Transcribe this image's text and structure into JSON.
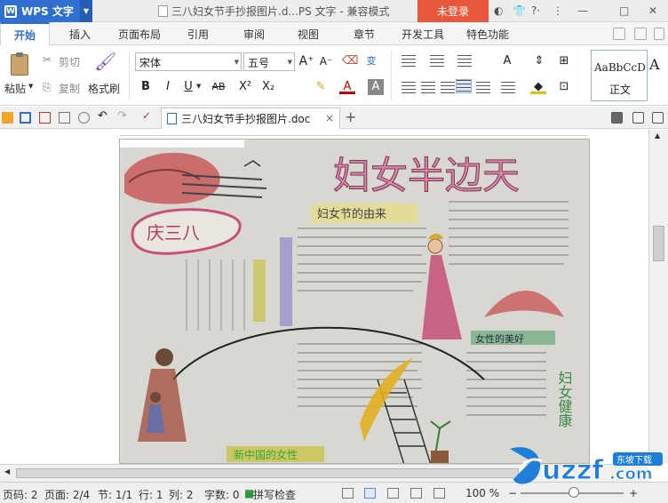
{
  "titlebar": {
    "app_name": "WPS 文字",
    "logo_letter": "W",
    "document_title": "三八妇女节手抄报图片.d...PS 文字 - 兼容模式",
    "login_label": "未登录"
  },
  "tabs": [
    "开始",
    "插入",
    "页面布局",
    "引用",
    "审阅",
    "视图",
    "章节",
    "开发工具",
    "特色功能"
  ],
  "ribbon": {
    "paste_label": "粘贴",
    "cut_label": "剪切",
    "copy_label": "复制",
    "format_painter_label": "格式刷",
    "font_name": "宋体",
    "font_size": "五号",
    "bold": "B",
    "italic": "I",
    "underline": "U",
    "strike": "AB",
    "superscript": "X²",
    "subscript": "X₂",
    "style_sample": "AaBbCcD",
    "style_name": "正文",
    "style_more": "A"
  },
  "doc_tab": {
    "name": "三八妇女节手抄报图片.doc",
    "close": "×",
    "add": "+"
  },
  "poster": {
    "headline": "妇女半边天",
    "badge": "庆三八",
    "subhead_left": "妇女节的由来",
    "subhead_right": "女性的美好",
    "bottom_banner": "新中国的女性",
    "side_text": "妇女健康"
  },
  "status": {
    "page_code": "页码: 2",
    "page": "页面: 2/4",
    "section": "节: 1/1",
    "row": "行: 1",
    "col": "列: 2",
    "words": "字数: 0",
    "spell": "拼写检查",
    "zoom": "100 %",
    "zoom_fraction": 0.52
  },
  "watermark": {
    "brand": "uzzf",
    "suffix": ".com",
    "tag": "东坡下载"
  },
  "colors": {
    "app_blue": "#2e6fcf",
    "login_red": "#e8573b",
    "poster_bg": "#d8d6d1",
    "poster_pink": "#c7507a",
    "watermark_blue": "#1f7fd8"
  }
}
